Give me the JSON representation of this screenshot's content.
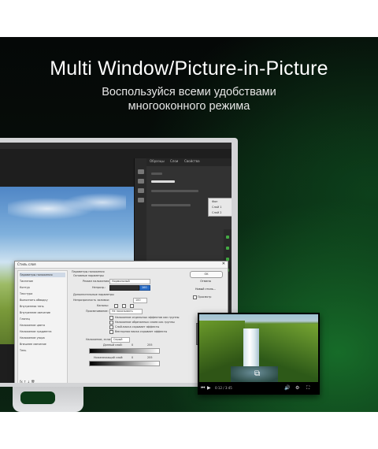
{
  "headline": "Multi Window/Picture-in-Picture",
  "subheadline": {
    "line1": "Воспользуйся всеми удобствами",
    "line2": "многооконного режима"
  },
  "photoshop": {
    "panel_tabs": [
      "Образцы",
      "Слои",
      "Свойства"
    ],
    "popup_items": [
      "Фон",
      "Слой 1",
      "Слой 2"
    ],
    "dialog": {
      "title": "Стиль слоя",
      "close": "✕",
      "left_items": [
        "Параметры наложения",
        "Тиснение",
        "Контур",
        "Текстура",
        "Выполнить обводку",
        "Внутренняя тень",
        "Внутреннее свечение",
        "Глянец",
        "Наложение цвета",
        "Наложение градиента",
        "Наложение узора",
        "Внешнее свечение",
        "Тень"
      ],
      "section_title": "Параметры наложения",
      "section_sub": "Основные параметры",
      "blend_mode_label": "Режим наложения:",
      "blend_mode_value": "Нормальный",
      "opacity_label": "Непрозр.:",
      "opacity_value": "100",
      "advanced_title": "Дополнительные параметры",
      "fill_label": "Непрозрачность заливки:",
      "fill_value": "100",
      "channels_label": "Каналы:",
      "knockout_label": "Просвечивание:",
      "knockout_value": "Не показывать",
      "options": [
        "Наложение отдельных эффектов как группы",
        "Наложение обрезанных слоев как группы",
        "Слой-маска скрывает эффекты",
        "Векторная маска скрывает эффекты"
      ],
      "blend_if_label": "Наложение, если:",
      "blend_if_value": "Серый",
      "this_layer_label": "Данный слой:",
      "this_layer_values": [
        "0",
        "255"
      ],
      "under_layer_label": "Нижележащий слой:",
      "under_layer_values": [
        "0",
        "255"
      ],
      "buttons": [
        "OK",
        "Отмена",
        "Новый стиль...",
        "Просмотр"
      ]
    }
  },
  "video_pip": {
    "popout_icon": "popout-icon",
    "controls": [
      "⏮",
      "▶",
      "⏭"
    ],
    "time": "0:12 / 3:45",
    "right_controls": [
      "🔊",
      "⚙",
      "⛶"
    ]
  }
}
